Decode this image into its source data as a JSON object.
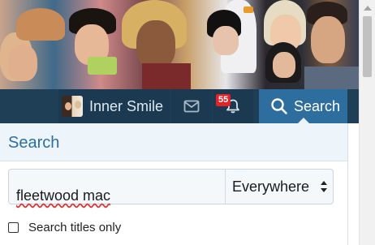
{
  "nav": {
    "username": "Inner Smile",
    "alerts_count": "55",
    "search_label": "Search",
    "icons": [
      "avatar",
      "mail-icon",
      "bell-icon",
      "search-icon"
    ]
  },
  "search_panel": {
    "title": "Search",
    "keywords_value": "fleetwood mac",
    "scope_value": "Everywhere",
    "titles_only_label": "Search titles only",
    "titles_only_checked": false
  },
  "colors": {
    "nav_bg": "#1f3f57",
    "active_tab": "#2e6e9e",
    "panel_header_bg": "#edf5fb",
    "badge": "#e0242a"
  }
}
